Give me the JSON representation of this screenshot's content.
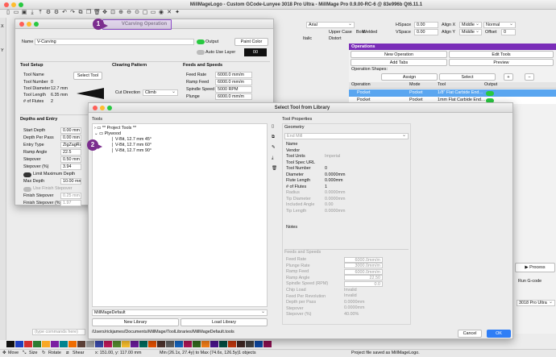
{
  "app": {
    "title": "MillMageLogo - Custom GCode-Lunyee 3018 Pro Ultra - MillMage Pro 0.9.00-RC-6 @ 83e996b Qt6.11.1"
  },
  "font_bar": {
    "font": "Arial",
    "hspace_label": "HSpace",
    "hspace": "0.00",
    "vspace_label": "VSpace",
    "vspace": "0.00",
    "alignx_label": "Align X",
    "alignx": "Middle",
    "aligny_label": "Align Y",
    "aligny": "Middle",
    "mode": "Normal",
    "offset_label": "Offset",
    "offset": "0",
    "bold": "Bold",
    "italic": "Italic",
    "upper_case": "Upper Case",
    "distort": "Distort",
    "welded": "Welded"
  },
  "operations_panel": {
    "title": "Operations",
    "new_operation": "New Operation",
    "edit_tools": "Edit Tools",
    "add_tabs": "Add Tabs",
    "preview": "Preview",
    "shapes_label": "Operation Shapes:",
    "assign": "Assign",
    "select": "Select",
    "columns": [
      "Operation",
      "Mode",
      "Tool",
      "Output"
    ],
    "rows": [
      {
        "operation": "Pocket",
        "mode": "Pocket",
        "tool": "1/8\" Flat Carbide End…"
      },
      {
        "operation": "Pocket",
        "mode": "Pocket",
        "tool": "1mm Flat Carbide End…"
      }
    ],
    "process": "Process",
    "run_gcode": "Run G-code",
    "device": "3018 Pro Ultra"
  },
  "vcarve": {
    "title": "VCarving Operation",
    "name_label": "Name",
    "name": "V-Carving",
    "output_label": "Output",
    "paint_color": "Paint Color",
    "auto_use_layer": "Auto Use Layer",
    "layer_num": "00",
    "tool_setup": {
      "title": "Tool Setup",
      "tool_name_label": "Tool Name",
      "select_tool": "Select Tool",
      "tool_number_label": "Tool Number",
      "tool_number": "0",
      "tool_diameter_label": "Tool Diameter",
      "tool_diameter": "12.7 mm",
      "tool_length_label": "Tool Length",
      "tool_length": "6.35 mm",
      "flutes_label": "# of Flutes",
      "flutes": "2"
    },
    "clearing": {
      "title": "Clearing Pattern",
      "cut_direction_label": "Cut Direction",
      "cut_direction": "Climb"
    },
    "feeds": {
      "title": "Feeds and Speeds",
      "feed_rate_label": "Feed Rate",
      "feed_rate": "6000.0 mm/m",
      "ramp_feed_label": "Ramp Feed",
      "ramp_feed": "6000.0 mm/m",
      "spindle_speed_label": "Spindle Speed",
      "spindle_speed": "5000 RPM",
      "plunge_label": "Plunge",
      "plunge": "6000.0 mm/m"
    },
    "depths": {
      "title": "Depths and Entry",
      "start_depth_label": "Start Depth",
      "start_depth": "0.00 mm",
      "depth_per_pass_label": "Depth Per Pass",
      "depth_per_pass": "0.00 mm",
      "entry_type_label": "Entry Type",
      "entry_type": "ZigZagRam",
      "ramp_angle_label": "Ramp Angle",
      "ramp_angle": "22.5",
      "stepover_label": "Stepover",
      "stepover": "0.50 mm",
      "stepover_pct_label": "Stepover (%)",
      "stepover_pct": "3.94",
      "limit_max_depth": "Limit Maximum Depth",
      "max_depth_label": "Max Depth",
      "max_depth": "10.00 mm",
      "use_finish_stepover": "Use Finish Stepover",
      "finish_stepover_label": "Finish Stepover",
      "finish_stepover": "0.25 mm",
      "finish_stepover_pct_label": "Finish Stepover (%)",
      "finish_stepover_pct": "1.97"
    }
  },
  "library": {
    "title": "Select Tool from Library",
    "tools_label": "Tools",
    "tree": {
      "project_tools": "** Project Tools **",
      "plywood": "Plywood",
      "items": [
        "V-Bit, 12.7 mm 45°",
        "V-Bit, 12.7 mm 60°",
        "V-Bit, 12.7 mm 90°"
      ]
    },
    "library_select": "MillMageDefault",
    "new_library": "New Library",
    "load_library": "Load Library",
    "path": "/Users/rickjames/Documents/MillMage/ToolLibraries/MillMageDefault.tools",
    "cancel": "Cancel",
    "ok": "OK",
    "props_title": "Tool Properties",
    "geometry": {
      "title": "Geometry",
      "type": "End Mill",
      "rows": [
        {
          "label": "Name",
          "value": ""
        },
        {
          "label": "Vendor",
          "value": ""
        },
        {
          "label": "Tool Units",
          "value": "Imperial"
        },
        {
          "label": "Tool Spec URL",
          "value": ""
        },
        {
          "label": "Tool Number",
          "value": "0"
        },
        {
          "label": "Diameter",
          "value": "0.0000mm"
        },
        {
          "label": "Flute Length",
          "value": "0.000mm"
        },
        {
          "label": "# of Flutes",
          "value": "1"
        },
        {
          "label": "Radius",
          "value": "0.0000mm"
        },
        {
          "label": "Tip Diameter",
          "value": "0.0000mm"
        },
        {
          "label": "Included Angle",
          "value": "0.00"
        },
        {
          "label": "Tip Length",
          "value": "0.0000mm"
        }
      ],
      "notes_label": "Notes"
    },
    "feeds": {
      "title": "Feeds and Speeds",
      "rows": [
        {
          "label": "Feed Rate",
          "value": "6000.0mm/m"
        },
        {
          "label": "Plunge Rate",
          "value": "3000.0mm/m"
        },
        {
          "label": "Ramp Feed",
          "value": "6000.0mm/m"
        },
        {
          "label": "Ramp Angle",
          "value": "22.50"
        },
        {
          "label": "Spindle Speed (RPM)",
          "value": "0.0"
        },
        {
          "label": "Chip Load",
          "value": "Invalid"
        },
        {
          "label": "Feed Per Revolution",
          "value": "Invalid"
        },
        {
          "label": "Depth per Pass",
          "value": "0.0000mm"
        },
        {
          "label": "Stepover",
          "value": "0.0000mm"
        },
        {
          "label": "Stepover (%)",
          "value": "40.00%"
        }
      ]
    }
  },
  "console": {
    "placeholder": "(type commands here)"
  },
  "statusbar": {
    "move": "Move",
    "size": "Size",
    "rotate": "Rotate",
    "shear": "Shear",
    "coords": "x: 151.00, y: 117.00 mm",
    "bounds": "Min (26.1x, 27.4y) to Max (74.6x, 126.5y)",
    "objects": "1 objects",
    "saved": "Project file saved as MillMageLogo."
  },
  "annotations": {
    "one": "1",
    "two": "2"
  },
  "colors": {
    "accent": "#2f7ef6",
    "badge": "#7b2d8e",
    "highlight": "#c8a8e8",
    "toggle_on": "#28c840"
  }
}
